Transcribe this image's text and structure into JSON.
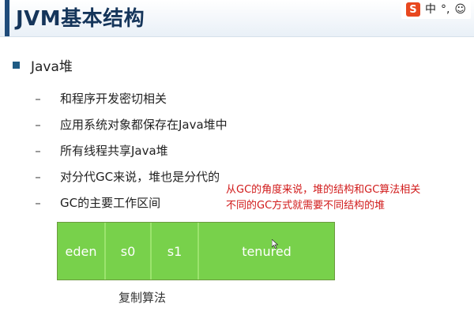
{
  "slide": {
    "title": "JVM基本结构",
    "main_bullet": "Java堆",
    "sub_items": [
      "和程序开发密切相关",
      "应用系统对象都保存在Java堆中",
      "所有线程共享Java堆",
      "对分代GC来说，堆也是分代的",
      "GC的主要工作区间"
    ],
    "annotation_lines": [
      "从GC的角度来说，堆的结构和GC算法相关",
      "不同的GC方式就需要不同结构的堆"
    ],
    "heap_cells": [
      "eden",
      "s0",
      "s1",
      "tenured"
    ],
    "caption": "复制算法"
  },
  "ime_toolbar": {
    "logo": "S",
    "lang": "中",
    "punct": "°,",
    "emoji": "☺"
  },
  "colors": {
    "title": "#15355a",
    "accent": "#1f4b7a",
    "heap_green": "#78d14b",
    "annotation_red": "#d11a1a"
  }
}
